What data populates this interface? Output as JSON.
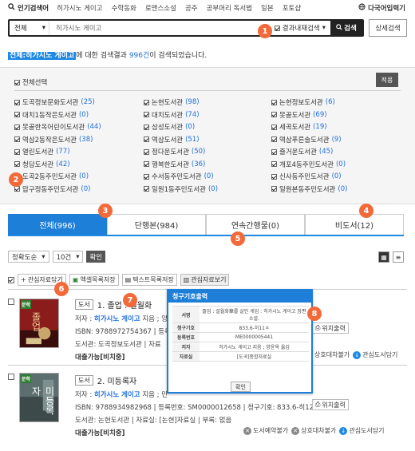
{
  "topnav": {
    "popular_label": "인기검색어",
    "keywords": [
      "히가시노 게이고",
      "수학동화",
      "로맨스소설",
      "공주",
      "공부머리 독서법",
      "일본",
      "포토샵"
    ],
    "multilang_label": "다국어입력기"
  },
  "search": {
    "scope": "전체",
    "query": "히가시노 게이고",
    "within_label": "결과내재검색",
    "button_label": "검색",
    "advanced_label": "상세검색"
  },
  "summary": {
    "keyword": "전체:히가시노 게이고",
    "middle": "에 대한 검색결과 ",
    "count": "996건",
    "tail": "이 검색되었습니다."
  },
  "filter": {
    "select_all": "전체선택",
    "apply_label": "적용",
    "libraries": [
      {
        "name": "도곡정보문화도서관",
        "count": "(25)"
      },
      {
        "name": "논현도서관",
        "count": "(98)"
      },
      {
        "name": "논현정보도서관",
        "count": "(6)"
      },
      {
        "name": "대치1동작은도서관",
        "count": "(0)"
      },
      {
        "name": "대치도서관",
        "count": "(74)"
      },
      {
        "name": "못골도서관",
        "count": "(69)"
      },
      {
        "name": "못골한옥어린이도서관",
        "count": "(44)"
      },
      {
        "name": "삼성도서관",
        "count": "(0)"
      },
      {
        "name": "세곡도서관",
        "count": "(19)"
      },
      {
        "name": "역삼2동작은도서관",
        "count": "(38)"
      },
      {
        "name": "역삼도서관",
        "count": "(51)"
      },
      {
        "name": "역삼푸른솔도서관",
        "count": "(9)"
      },
      {
        "name": "열린도서관",
        "count": "(77)"
      },
      {
        "name": "정다운도서관",
        "count": "(50)"
      },
      {
        "name": "즐거운도서관",
        "count": "(45)"
      },
      {
        "name": "청담도서관",
        "count": "(42)"
      },
      {
        "name": "행복한도서관",
        "count": "(36)"
      },
      {
        "name": "개포4동주민도서관",
        "count": "(0)"
      },
      {
        "name": "도곡2동주민도서관",
        "count": "(0)"
      },
      {
        "name": "수서동주민도서관",
        "count": "(0)"
      },
      {
        "name": "신사동주민도서관",
        "count": "(0)"
      },
      {
        "name": "압구정동주민도서관",
        "count": "(0)"
      },
      {
        "name": "일원1동주민도서관",
        "count": "(0)"
      },
      {
        "name": "일원본동주민도서관",
        "count": "(0)"
      }
    ]
  },
  "tabs": [
    {
      "label": "전체(996)"
    },
    {
      "label": "단행본(984)"
    },
    {
      "label": "연속간행물(0)"
    },
    {
      "label": "비도서(12)"
    }
  ],
  "sort": {
    "order": "정확도순",
    "size": "10건",
    "confirm": "확인"
  },
  "toolbar": {
    "basket": "관심자료담기",
    "excel": "엑셀목록저장",
    "text": "텍스트목록저장",
    "view": "관심자료보기"
  },
  "results": [
    {
      "kind": "도서",
      "title": "1. 졸업 : 설월화",
      "cover_tag": "문학",
      "cover_title": "졸업",
      "author_prefix": "저자 : ",
      "author": "히가시노 게이고",
      "author_suffix": " 지음 ; 양",
      "isbn": "ISBN: 9788972754367",
      "reg": "등록",
      "library": "도서관: 도곡정보도서관",
      "room": "자료",
      "avail": "대출가능[비치중]",
      "actions": [
        "상호대차불가",
        "관심도서담기"
      ],
      "pos_label": "위치출력"
    },
    {
      "kind": "도서",
      "title": "2. 미등록자",
      "cover_tag": "문학",
      "cover_title": "미등록자",
      "author_prefix": "저자 : ",
      "author": "히가시노 게이고",
      "author_suffix": " 지음 ; 민",
      "isbn": "ISBN: 9788934982968",
      "reg": "등록번호: SM0000012658",
      "callno": "청구기호: 833.6-히12",
      "library": "도서관: 논현도서관",
      "room": "자료실: [논현]자료실",
      "extra": "부록: 없음",
      "avail": "대출가능[비치중]",
      "actions": [
        "도서예약불가",
        "상호대차불가",
        "관심도서담기"
      ],
      "pos_label": "위치출력"
    }
  ],
  "popup": {
    "title": "청구기호출력",
    "rows": [
      {
        "k": "서명",
        "v": "졸업 : 설월화華를 살인 게임 : 히가시노 게이고 장편소설."
      },
      {
        "k": "청구기호",
        "v": "833.6-히11ㅈ"
      },
      {
        "k": "등록번호",
        "v": "ME0000005441"
      },
      {
        "k": "저자",
        "v": "히가시노 게이고 지음 ; 양윤옥 옮김"
      },
      {
        "k": "자료실",
        "v": "[도곡]종합자료실"
      }
    ],
    "confirm": "확인"
  },
  "markers": [
    "1",
    "2",
    "3",
    "4",
    "5",
    "6",
    "7",
    "8"
  ],
  "colors": {
    "accent": "#1e7fd9",
    "marker": "#f26a3a",
    "dark": "#222222"
  }
}
